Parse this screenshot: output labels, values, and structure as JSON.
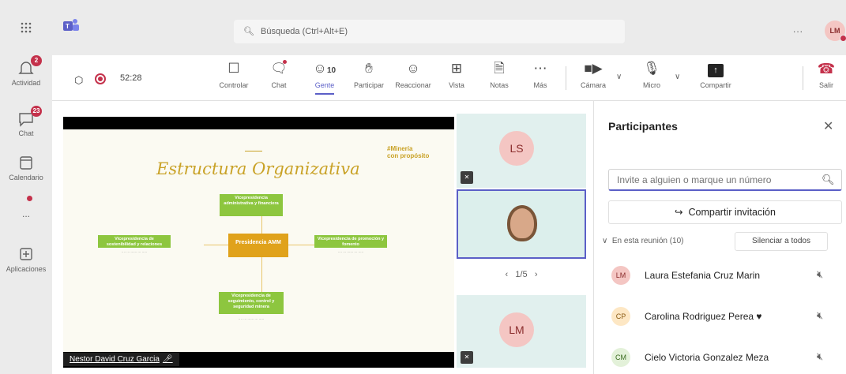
{
  "rail": {
    "apps_icon": "grid-icon",
    "items": [
      {
        "label": "Actividad",
        "badge": "2"
      },
      {
        "label": "Chat",
        "badge": "23"
      },
      {
        "label": "Calendario",
        "badge": ""
      },
      {
        "label": "...",
        "badge": ""
      },
      {
        "label": "Aplicaciones",
        "badge": ""
      }
    ]
  },
  "top": {
    "search_placeholder": "Búsqueda (Ctrl+Alt+E)",
    "more": "...",
    "user_initials": "LM"
  },
  "controls": {
    "timer": "52:28",
    "people_count": "10",
    "buttons": [
      {
        "label": "Controlar",
        "icon": "control-icon"
      },
      {
        "label": "Chat",
        "icon": "chat-icon"
      },
      {
        "label": "Gente",
        "icon": "people-icon"
      },
      {
        "label": "Participar",
        "icon": "raise-hand-icon"
      },
      {
        "label": "Reaccionar",
        "icon": "smiley-icon"
      },
      {
        "label": "Vista",
        "icon": "view-grid-icon"
      },
      {
        "label": "Notas",
        "icon": "notes-icon"
      },
      {
        "label": "Más",
        "icon": "more-icon"
      },
      {
        "label": "Cámara",
        "icon": "camera-off-icon"
      },
      {
        "label": "Micro",
        "icon": "mic-off-icon"
      },
      {
        "label": "Compartir",
        "icon": "share-icon"
      },
      {
        "label": "Salir",
        "icon": "hang-up-icon"
      }
    ]
  },
  "slide": {
    "title": "Estructura Organizativa",
    "logo_line1": "#Minería",
    "logo_line2": "con propósito",
    "center_box": "Presidencia AMM",
    "boxes": [
      "Vicepresidencia administrativa y financiera",
      "Vicepresidencia de sostenibilidad y relaciones",
      "Vicepresidencia de promoción y fomento",
      "Vicepresidencia de seguimiento, control y seguridad minera"
    ],
    "presenter": "Nestor David Cruz Garcia"
  },
  "tiles": {
    "top_initials": "LS",
    "bottom_initials": "LM",
    "pager": "1/5"
  },
  "panel": {
    "title": "Participantes",
    "invite_placeholder": "Invite a alguien o marque un número",
    "share_invite": "Compartir invitación",
    "section": "En esta reunión (10)",
    "mute_all": "Silenciar a todos",
    "participants": [
      {
        "initials": "LM",
        "name": "Laura Estefania Cruz Marin",
        "bg": "#f4c6c3",
        "fg": "#8a2c2c"
      },
      {
        "initials": "CP",
        "name": "Carolina Rodriguez Perea",
        "bg": "#fde7c4",
        "fg": "#8a5a14"
      },
      {
        "initials": "CM",
        "name": "Cielo Victoria Gonzalez Meza",
        "bg": "#e3f1d9",
        "fg": "#3a6b1f"
      }
    ]
  }
}
